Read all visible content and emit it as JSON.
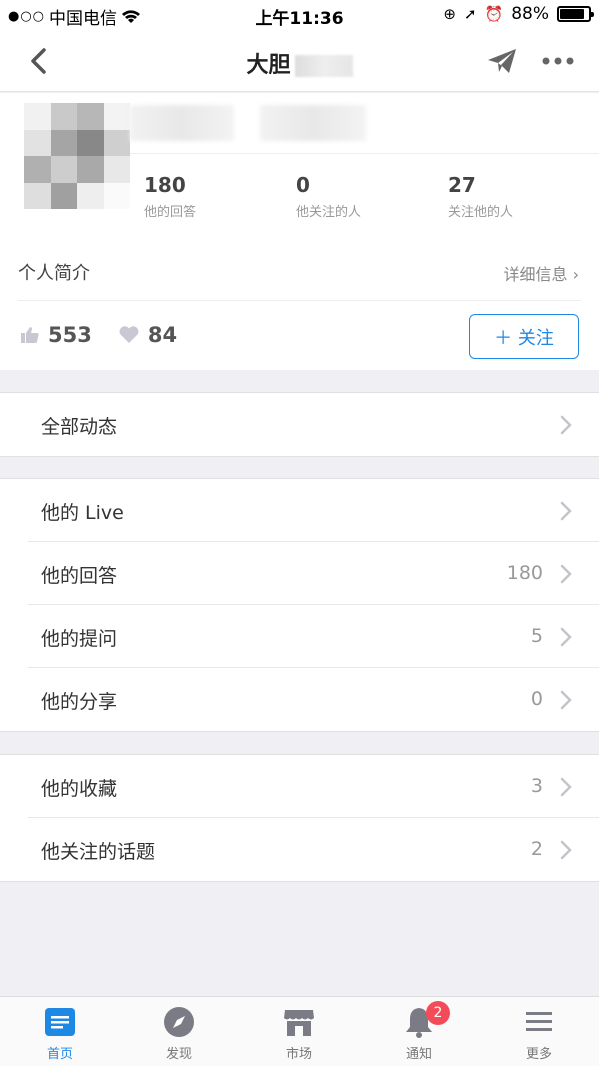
{
  "status_bar": {
    "carrier": "中国电信",
    "time": "上午11:36",
    "battery": "88%",
    "battery_level": 0.88
  },
  "nav": {
    "title": "大胆",
    "back_icon": "chevron-left-icon",
    "send_icon": "paper-plane-icon",
    "more_icon": "more-dots-icon"
  },
  "profile": {
    "stats": [
      {
        "num": "180",
        "label": "他的回答"
      },
      {
        "num": "0",
        "label": "他关注的人"
      },
      {
        "num": "27",
        "label": "关注他的人"
      }
    ],
    "intro_label": "个人简介",
    "detail_label": "详细信息 ›",
    "likes": "553",
    "thanks": "84",
    "follow_label": "＋ 关注"
  },
  "groups": [
    {
      "rows": [
        {
          "label": "全部动态",
          "count": ""
        }
      ]
    },
    {
      "rows": [
        {
          "label": "他的 Live",
          "count": ""
        },
        {
          "label": "他的回答",
          "count": "180"
        },
        {
          "label": "他的提问",
          "count": "5"
        },
        {
          "label": "他的分享",
          "count": "0"
        }
      ]
    },
    {
      "rows": [
        {
          "label": "他的收藏",
          "count": "3"
        },
        {
          "label": "他关注的话题",
          "count": "2"
        }
      ]
    }
  ],
  "tabbar": {
    "tabs": [
      {
        "label": "首页",
        "icon": "home-feed-icon"
      },
      {
        "label": "发现",
        "icon": "compass-icon"
      },
      {
        "label": "市场",
        "icon": "store-icon"
      },
      {
        "label": "通知",
        "icon": "bell-icon",
        "badge": "2"
      },
      {
        "label": "更多",
        "icon": "menu-icon"
      }
    ]
  },
  "colors": {
    "accent": "#1e88e5",
    "badge": "#f44b58",
    "background": "#efeff4"
  }
}
